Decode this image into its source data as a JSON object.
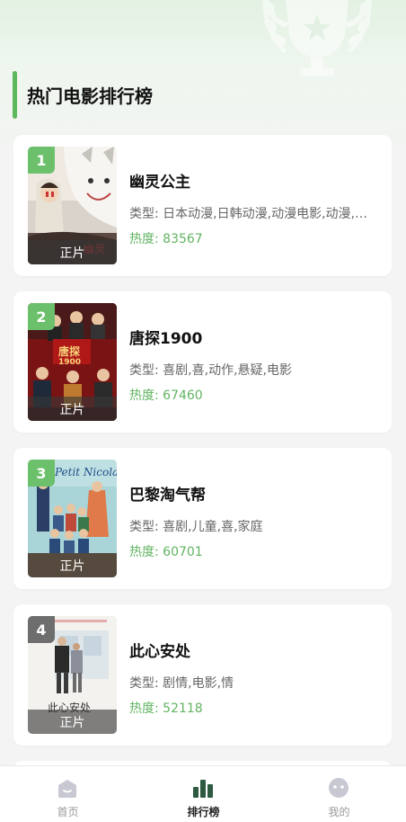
{
  "section": {
    "title": "热门电影排行榜"
  },
  "movies": [
    {
      "rank": "1",
      "title": "幽灵公主",
      "type": "类型: 日本动漫,日韩动漫,动漫电影,动漫,动画",
      "heat": "热度: 83567",
      "tag": "正片",
      "poster_text": ""
    },
    {
      "rank": "2",
      "title": "唐探1900",
      "type": "类型: 喜剧,喜,动作,悬疑,电影",
      "heat": "热度: 67460",
      "tag": "正片",
      "poster_text": "唐探 1900"
    },
    {
      "rank": "3",
      "title": "巴黎淘气帮",
      "type": "类型: 喜剧,儿童,喜,家庭",
      "heat": "热度: 60701",
      "tag": "正片",
      "poster_text": "Petit Nicolas"
    },
    {
      "rank": "4",
      "title": "此心安处",
      "type": "类型: 剧情,电影,情",
      "heat": "热度: 52118",
      "tag": "正片",
      "poster_text": "此心安处"
    }
  ],
  "tabbar": {
    "home": "首页",
    "ranking": "排行榜",
    "mine": "我的"
  },
  "colors": {
    "accent": "#5cb85c",
    "heat": "#62b462",
    "rank_badge": "#6cc06c"
  },
  "icons": {
    "home": "home-icon",
    "ranking": "bar-chart-icon",
    "mine": "smiley-icon",
    "decoration": "trophy-icon"
  }
}
